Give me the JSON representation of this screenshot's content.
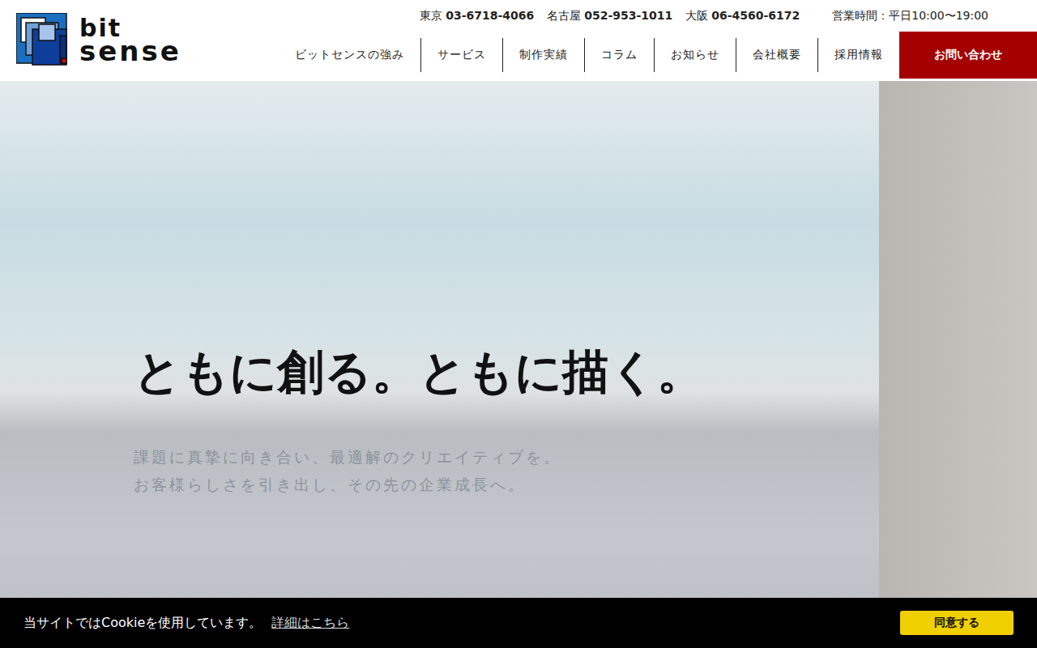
{
  "logo": {
    "line1": "bit",
    "line2": "sense"
  },
  "contacts": [
    {
      "city": "東京",
      "phone": "03-6718-4066"
    },
    {
      "city": "名古屋",
      "phone": "052-953-1011"
    },
    {
      "city": "大阪",
      "phone": "06-4560-6172"
    }
  ],
  "hours": "営業時間：平日10:00〜19:00",
  "nav": [
    "ビットセンスの強み",
    "サービス",
    "制作実績",
    "コラム",
    "お知らせ",
    "会社概要",
    "採用情報"
  ],
  "cta": "お問い合わせ",
  "hero": {
    "headline": "ともに創る。ともに描く。",
    "subline": [
      "課題に真摯に向き合い、最適解のクリエイティブを。",
      "お客様らしさを引き出し、その先の企業成長へ。"
    ]
  },
  "cookie": {
    "message": "当サイトではCookieを使用しています。",
    "link": "詳細はこちら",
    "button": "同意する"
  }
}
